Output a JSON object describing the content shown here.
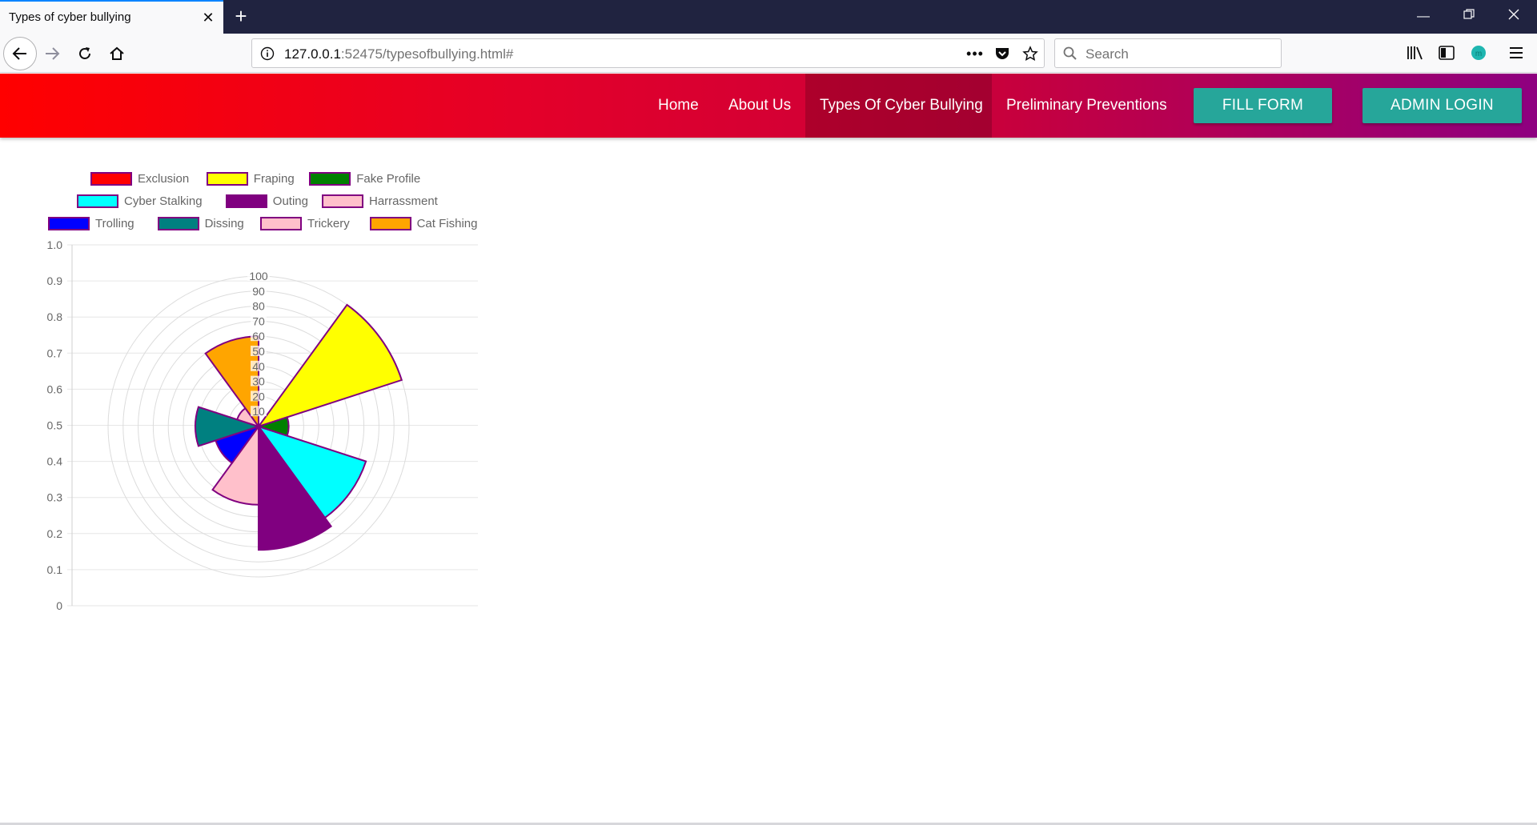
{
  "browser": {
    "tab_title": "Types of cyber bullying",
    "url_host": "127.0.0.1",
    "url_rest": ":52475/typesofbullying.html#",
    "search_placeholder": "Search"
  },
  "header": {
    "nav": [
      "Home",
      "About Us",
      "Types Of Cyber Bullying",
      "Preliminary Preventions"
    ],
    "active_nav": "Types Of Cyber Bullying",
    "fill_form": "FILL FORM",
    "admin_login": "ADMIN LOGIN",
    "button_color": "#26a69a"
  },
  "chart_data": {
    "type": "polarArea",
    "categories": [
      "Exclusion",
      "Fraping",
      "Fake Profile",
      "Cyber Stalking",
      "Outing",
      "Harrassment",
      "Trolling",
      "Dissing",
      "Trickery",
      "Cat Fishing"
    ],
    "values": [
      0,
      100,
      20,
      75,
      82,
      52,
      30,
      42,
      15,
      60
    ],
    "colors": [
      "#ff0000",
      "#ffff00",
      "#008000",
      "#00ffff",
      "#800080",
      "#ffc0cb",
      "#0000ff",
      "#008080",
      "#ffc0cb",
      "#ffa500"
    ],
    "border_color": "#800080",
    "radial_ticks": [
      "10",
      "20",
      "30",
      "40",
      "50",
      "60",
      "70",
      "80",
      "90",
      "100"
    ],
    "y_ticks": [
      "0",
      "0.1",
      "0.2",
      "0.3",
      "0.4",
      "0.5",
      "0.6",
      "0.7",
      "0.8",
      "0.9",
      "1.0"
    ],
    "rlim": [
      0,
      100
    ],
    "ylim": [
      0,
      1
    ],
    "legend_position": "top"
  }
}
